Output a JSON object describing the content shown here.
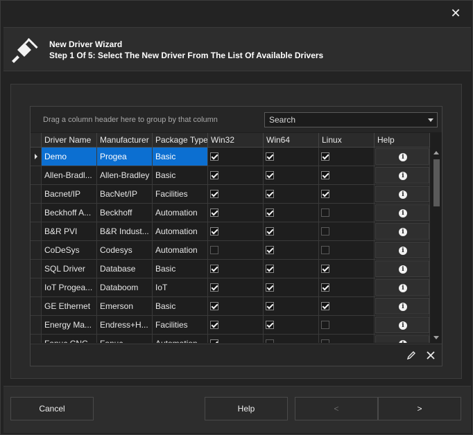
{
  "window": {
    "close_glyph": "✕"
  },
  "header": {
    "icon": "plug-icon",
    "title": "New Driver Wizard",
    "subtitle": "Step 1 Of 5: Select The New Driver From The List Of Available Drivers"
  },
  "grid": {
    "group_hint": "Drag a column header here to group by that column",
    "search_value": "Search",
    "columns": [
      "Driver Name",
      "Manufacturer",
      "Package Type",
      "Win32",
      "Win64",
      "Linux",
      "Help"
    ],
    "rows": [
      {
        "name": "Demo",
        "manufacturer": "Progea",
        "package": "Basic",
        "win32": true,
        "win64": true,
        "linux": true,
        "selected": true
      },
      {
        "name": "Allen-Bradl...",
        "manufacturer": "Allen-Bradley",
        "package": "Basic",
        "win32": true,
        "win64": true,
        "linux": true
      },
      {
        "name": "Bacnet/IP",
        "manufacturer": "BacNet/IP",
        "package": "Facilities",
        "win32": true,
        "win64": true,
        "linux": true
      },
      {
        "name": "Beckhoff A...",
        "manufacturer": "Beckhoff",
        "package": "Automation",
        "win32": true,
        "win64": true,
        "linux": false
      },
      {
        "name": "B&R PVI",
        "manufacturer": "B&R Indust...",
        "package": "Automation",
        "win32": true,
        "win64": true,
        "linux": false
      },
      {
        "name": "CoDeSys",
        "manufacturer": "Codesys",
        "package": "Automation",
        "win32": false,
        "win64": true,
        "linux": false
      },
      {
        "name": "SQL Driver",
        "manufacturer": "Database",
        "package": "Basic",
        "win32": true,
        "win64": true,
        "linux": true
      },
      {
        "name": "IoT Progea...",
        "manufacturer": "Databoom",
        "package": "IoT",
        "win32": true,
        "win64": true,
        "linux": true
      },
      {
        "name": "GE Ethernet",
        "manufacturer": "Emerson",
        "package": "Basic",
        "win32": true,
        "win64": true,
        "linux": true
      },
      {
        "name": "Energy Ma...",
        "manufacturer": "Endress+H...",
        "package": "Facilities",
        "win32": true,
        "win64": true,
        "linux": false
      },
      {
        "name": "Fanuc CNC",
        "manufacturer": "Fanuc",
        "package": "Automation",
        "win32": true,
        "win64": false,
        "linux": false
      }
    ],
    "footer": {
      "edit_icon": "pencil-icon",
      "clear_icon": "close-icon"
    }
  },
  "buttons": {
    "cancel": "Cancel",
    "help": "Help",
    "back": "<",
    "next": ">"
  }
}
